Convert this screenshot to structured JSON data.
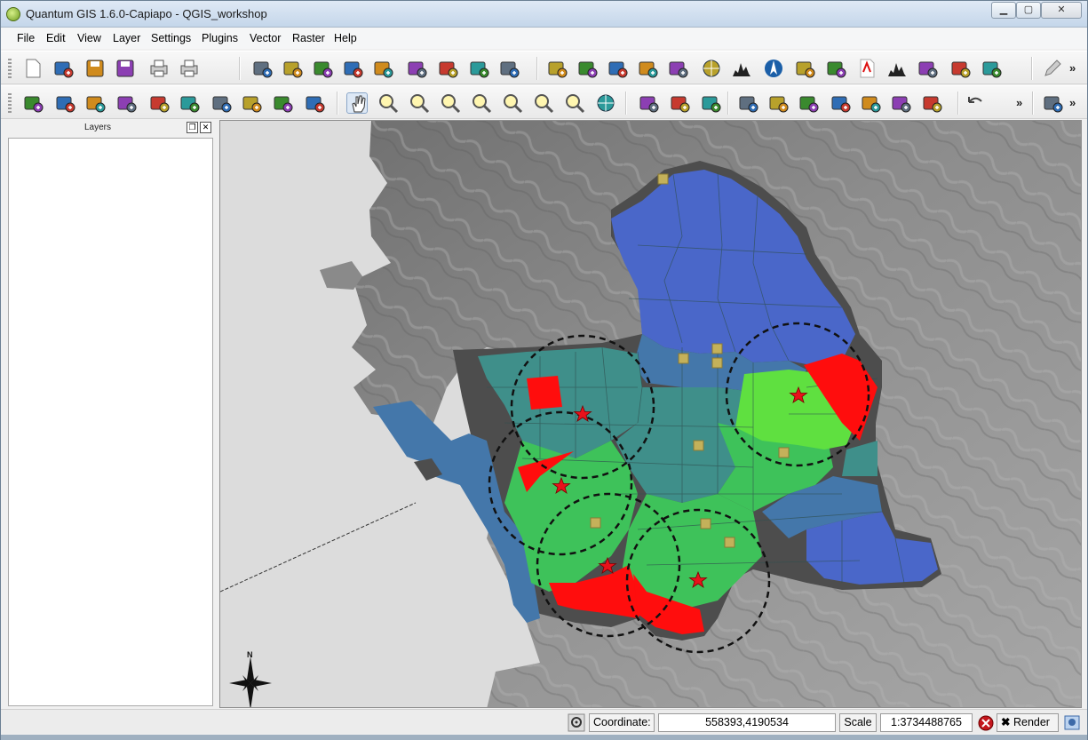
{
  "window": {
    "title": "Quantum GIS 1.6.0-Capiapo - QGIS_workshop",
    "minimize_label": "▁",
    "maximize_label": "▢",
    "close_label": "✕"
  },
  "menu": [
    "File",
    "Edit",
    "View",
    "Layer",
    "Settings",
    "Plugins",
    "Vector",
    "Raster",
    "Help"
  ],
  "toolbar1": {
    "tools": [
      "new-project-icon",
      "open-project-icon",
      "save-project-icon",
      "save-as-icon",
      "print-composer-icon",
      "print-icon",
      "add-vector-layer-icon",
      "add-raster-layer-icon",
      "add-postgis-layer-icon",
      "add-spatialite-layer-icon",
      "add-wms-layer-icon",
      "new-shapefile-icon",
      "remove-layer-icon",
      "add-wfs-layer-icon",
      "georeferencer-icon",
      "gps-tools-icon",
      "coordinate-capture-icon",
      "grass-tools-icon",
      "vd-icon",
      "raster-calculator-icon",
      "globe-icon",
      "histogram-icon",
      "north-arrow-icon",
      "ogr-converter-icon",
      "spatial-query-icon",
      "pdf-icon",
      "chart-icon",
      "raster-layer-icon",
      "elephant-icon",
      "image-export-icon",
      "pencil-icon"
    ],
    "overflow": "»"
  },
  "toolbar2": {
    "tools": [
      "identify-icon",
      "select-icon",
      "deselect-icon",
      "attribute-table-icon",
      "measure-icon",
      "map-tips-icon",
      "home-icon",
      "home-plus-icon",
      "label-icon",
      "text-annotation-icon",
      "pan-icon",
      "zoom-in-icon",
      "zoom-out-icon",
      "zoom-full-icon",
      "zoom-selection-icon",
      "zoom-layer-icon",
      "zoom-last-icon",
      "zoom-next-icon",
      "refresh-icon",
      "add-feature-icon",
      "star-feature-icon",
      "delete-feature-icon",
      "edit-node-icon",
      "split-icon",
      "merge-icon",
      "move-icon",
      "rotate-icon",
      "simplify-icon",
      "reshape-icon",
      "undo-icon",
      "add-part-icon"
    ],
    "overflow": "»",
    "overflow2": "»"
  },
  "layers_panel": {
    "title": "Layers",
    "float_label": "❐",
    "close_label": "✕"
  },
  "map": {
    "north_label": "N",
    "colors": {
      "background": "#7f7f7f",
      "water": "#dcdcdc",
      "boundary": "#4a4a4a",
      "blue": "#4a67c9",
      "steel": "#4477aa",
      "teal": "#3f8f8a",
      "green": "#3ec25a",
      "light_green": "#5fe040",
      "red": "#ff0d0d",
      "point": "#c4b15a"
    }
  },
  "status": {
    "coordinate_label": "Coordinate:",
    "coordinate_value": "558393,4190534",
    "scale_label": "Scale",
    "scale_value": "1:3734488765",
    "render_label": "Render"
  }
}
